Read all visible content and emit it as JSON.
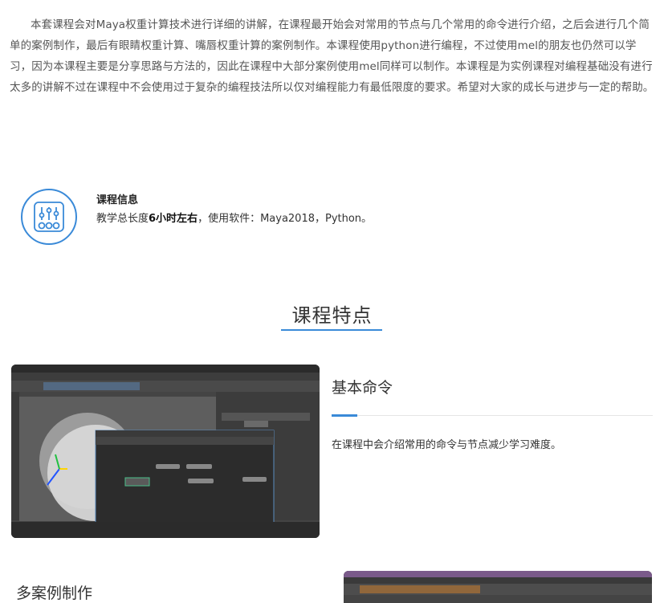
{
  "intro": {
    "text": "本套课程会对Maya权重计算技术进行详细的讲解，在课程最开始会对常用的节点与几个常用的命令进行介绍，之后会进行几个简单的案例制作，最后有眼睛权重计算、嘴唇权重计算的案例制作。本课程使用python进行编程，不过使用mel的朋友也仍然可以学习，因为本课程主要是分享思路与方法的，因此在课程中大部分案例使用mel同样可以制作。本课程是为实例课程对编程基础没有进行太多的讲解不过在课程中不会使用过于复杂的编程技法所以仅对编程能力有最低限度的要求。希望对大家的成长与进步与一定的帮助。"
  },
  "course_info": {
    "icon": "sliders-icon",
    "title": "课程信息",
    "desc_prefix": "教学总长度",
    "duration": "6小时左右",
    "desc_suffix": "，使用软件：Maya2018，Python。"
  },
  "features": {
    "heading": "课程特点",
    "items": [
      {
        "title": "基本命令",
        "desc": "在课程中会介绍常用的命令与节点减少学习难度。"
      },
      {
        "title": "多案例制作"
      }
    ]
  },
  "colors": {
    "accent": "#3a8ad8",
    "text": "#333333",
    "muted": "#555555"
  }
}
